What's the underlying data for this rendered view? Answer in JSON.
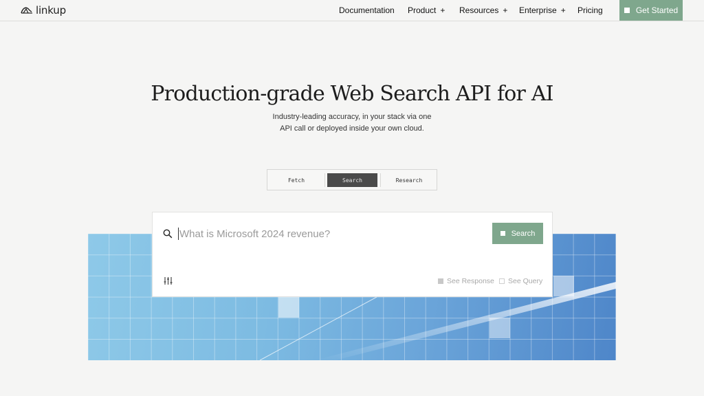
{
  "header": {
    "logo_text": "linkup",
    "nav": [
      {
        "label": "Documentation",
        "has_plus": false
      },
      {
        "label": "Product",
        "has_plus": true
      },
      {
        "label": "Resources",
        "has_plus": true
      },
      {
        "label": "Enterprise",
        "has_plus": true
      },
      {
        "label": "Pricing",
        "has_plus": false
      }
    ],
    "plus_symbol": "+",
    "cta_label": "Get Started"
  },
  "hero": {
    "title": "Production-grade Web Search API for AI",
    "subtitle_line1": "Industry-leading accuracy, in your stack via one",
    "subtitle_line2": "API call or deployed inside your own cloud."
  },
  "tabs": [
    {
      "label": "Fetch",
      "active": false
    },
    {
      "label": "Search",
      "active": true
    },
    {
      "label": "Research",
      "active": false
    }
  ],
  "search": {
    "placeholder": "What is Microsoft 2024 revenue?",
    "value": "",
    "button_label": "Search",
    "options": [
      {
        "label": "See Response",
        "checked": true
      },
      {
        "label": "See Query",
        "checked": false
      }
    ]
  },
  "icons": {
    "logo": "linkup-logo-icon",
    "search": "search-icon",
    "filter": "sliders-icon"
  },
  "colors": {
    "accent_green": "#7fa78d",
    "background": "#f5f5f4",
    "active_tab": "#4a4a4a"
  }
}
